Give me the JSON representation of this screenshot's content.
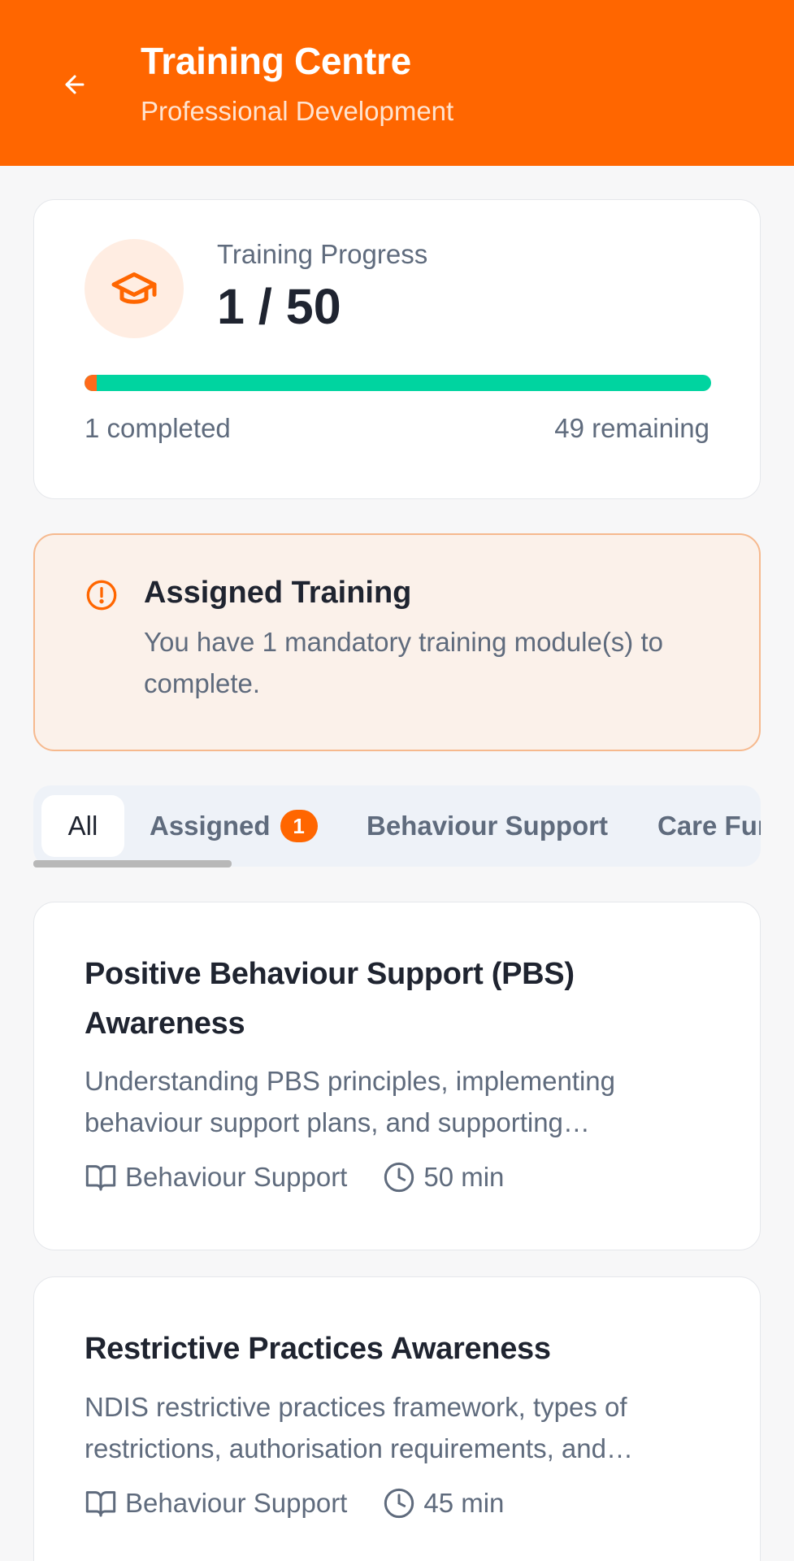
{
  "header": {
    "title": "Training Centre",
    "subtitle": "Professional Development",
    "accent": "#ff6600"
  },
  "progress": {
    "label": "Training Progress",
    "count": "1 / 50",
    "completed": 1,
    "total": 50,
    "completed_text": "1 completed",
    "remaining_text": "49 remaining"
  },
  "assigned": {
    "icon": "alert-circle-icon",
    "title": "Assigned Training",
    "description": "You have 1 mandatory training module(s) to complete."
  },
  "tabs": [
    {
      "label": "All",
      "active": true
    },
    {
      "label": "Assigned",
      "badge": "1"
    },
    {
      "label": "Behaviour Support"
    },
    {
      "label": "Care Fur"
    }
  ],
  "modules": [
    {
      "title": "Positive Behaviour Support (PBS) Awareness",
      "description": "Understanding PBS principles, implementing behaviour support plans, and supporting…",
      "category": "Behaviour Support",
      "duration": "50 min"
    },
    {
      "title": "Restrictive Practices Awareness",
      "description": "NDIS restrictive practices framework, types of restrictions, authorisation requirements, and…",
      "category": "Behaviour Support",
      "duration": "45 min"
    }
  ]
}
